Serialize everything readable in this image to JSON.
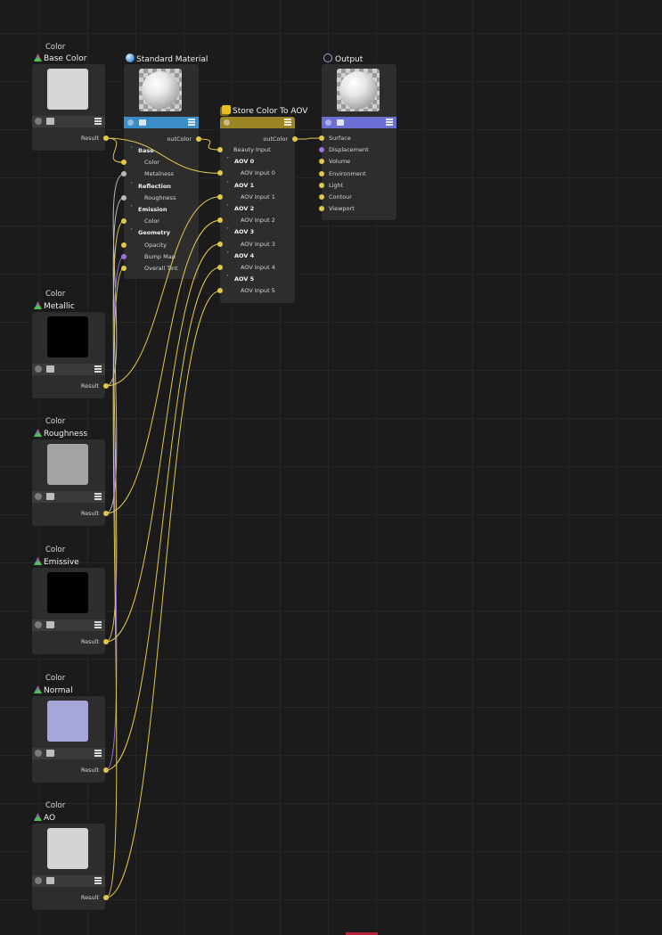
{
  "color_nodes": [
    {
      "type_label": "Color",
      "title": "Base Color",
      "swatch": "#d6d6d6",
      "output": "Result"
    },
    {
      "type_label": "Color",
      "title": "Metallic",
      "swatch": "#000000",
      "output": "Result"
    },
    {
      "type_label": "Color",
      "title": "Roughness",
      "swatch": "#a3a3a3",
      "output": "Result"
    },
    {
      "type_label": "Color",
      "title": "Emissive",
      "swatch": "#000000",
      "output": "Result"
    },
    {
      "type_label": "Color",
      "title": "Normal",
      "swatch": "#a6a7d8",
      "output": "Result"
    },
    {
      "type_label": "Color",
      "title": "AO",
      "swatch": "#d3d3d3",
      "output": "Result"
    }
  ],
  "standard_material": {
    "title": "Standard Material",
    "header_color": "#3b8cc7",
    "output": "outColor",
    "rows": [
      {
        "kind": "group",
        "label": "Base"
      },
      {
        "kind": "input",
        "label": "Color"
      },
      {
        "kind": "input",
        "label": "Metalness"
      },
      {
        "kind": "group",
        "label": "Reflection"
      },
      {
        "kind": "input",
        "label": "Roughness"
      },
      {
        "kind": "group",
        "label": "Emission"
      },
      {
        "kind": "input",
        "label": "Color"
      },
      {
        "kind": "group",
        "label": "Geometry"
      },
      {
        "kind": "input",
        "label": "Opacity"
      },
      {
        "kind": "input",
        "label": "Bump Map"
      },
      {
        "kind": "input",
        "label": "Overall Tint"
      }
    ]
  },
  "store_aov": {
    "title": "Store Color To AOV",
    "header_color": "#9a8626",
    "output": "outColor",
    "rows": [
      {
        "kind": "input",
        "label": "Beauty Input"
      },
      {
        "kind": "group",
        "label": "AOV 0"
      },
      {
        "kind": "input",
        "label": "AOV Input 0"
      },
      {
        "kind": "group",
        "label": "AOV 1"
      },
      {
        "kind": "input",
        "label": "AOV Input 1"
      },
      {
        "kind": "group",
        "label": "AOV 2"
      },
      {
        "kind": "input",
        "label": "AOV Input 2"
      },
      {
        "kind": "group",
        "label": "AOV 3"
      },
      {
        "kind": "input",
        "label": "AOV Input 3"
      },
      {
        "kind": "group",
        "label": "AOV 4"
      },
      {
        "kind": "input",
        "label": "AOV Input 4"
      },
      {
        "kind": "group",
        "label": "AOV 5"
      },
      {
        "kind": "input",
        "label": "AOV Input 5"
      }
    ]
  },
  "output_node": {
    "title": "Output",
    "header_color": "#6b6fd3",
    "inputs": [
      "Surface",
      "Displacement",
      "Volume",
      "Environment",
      "Light",
      "Contour",
      "Viewport"
    ]
  },
  "colors": {
    "wire": "#e0c74c",
    "wire_grey": "#b9b9b9",
    "wire_purple": "#9c71e0",
    "background": "#1b1b1b",
    "node_body": "#2d2d2d"
  }
}
